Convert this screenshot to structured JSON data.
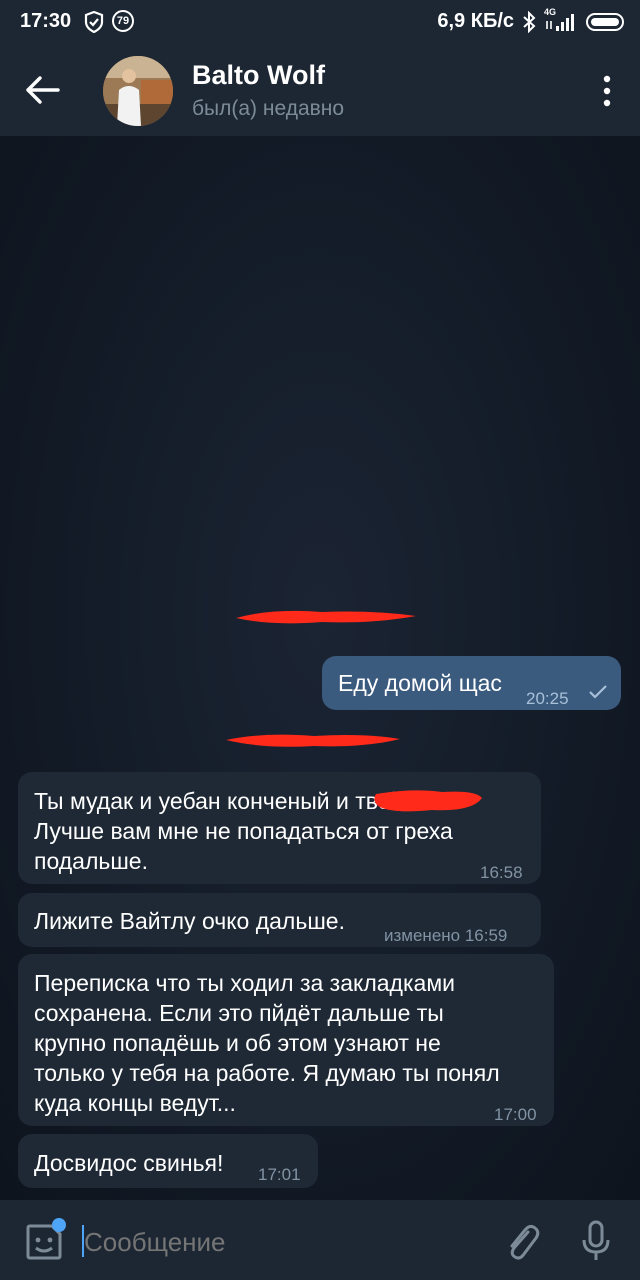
{
  "status_bar": {
    "time": "17:30",
    "badge": "79",
    "speed": "6,9 КБ/с",
    "network": "4G"
  },
  "header": {
    "contact_name": "Balto Wolf",
    "last_seen": "был(а) недавно"
  },
  "messages": [
    {
      "direction": "out",
      "text": "Еду домой щас",
      "time": "20:25",
      "read_icon": "check-icon"
    },
    {
      "direction": "in",
      "text": "Ты мудак и уебан конченый и           твой.\nЛучше вам мне не попадаться от греха\nподальше.",
      "time": "16:58"
    },
    {
      "direction": "in",
      "text": "Лижите Вайтлу очко дальше.",
      "time": "изменено 16:59"
    },
    {
      "direction": "in",
      "text": "Переписка что ты ходил за закладками\nсохранена. Если это пйдёт дальше ты\nкрупно попадёшь и об этом узнают не\nтолько у тебя на работе. Я думаю ты понял\nкуда концы ведут...",
      "time": "17:00"
    },
    {
      "direction": "in",
      "text": "Досвидос свинья!",
      "time": "17:01"
    }
  ],
  "composer": {
    "placeholder": "Сообщение"
  },
  "colors": {
    "header_bg": "#1c2733",
    "incoming_bubble": "#1e2935",
    "outgoing_bubble": "#3a5a7e",
    "accent": "#4ea4f6",
    "redaction": "#ff2a1a"
  }
}
